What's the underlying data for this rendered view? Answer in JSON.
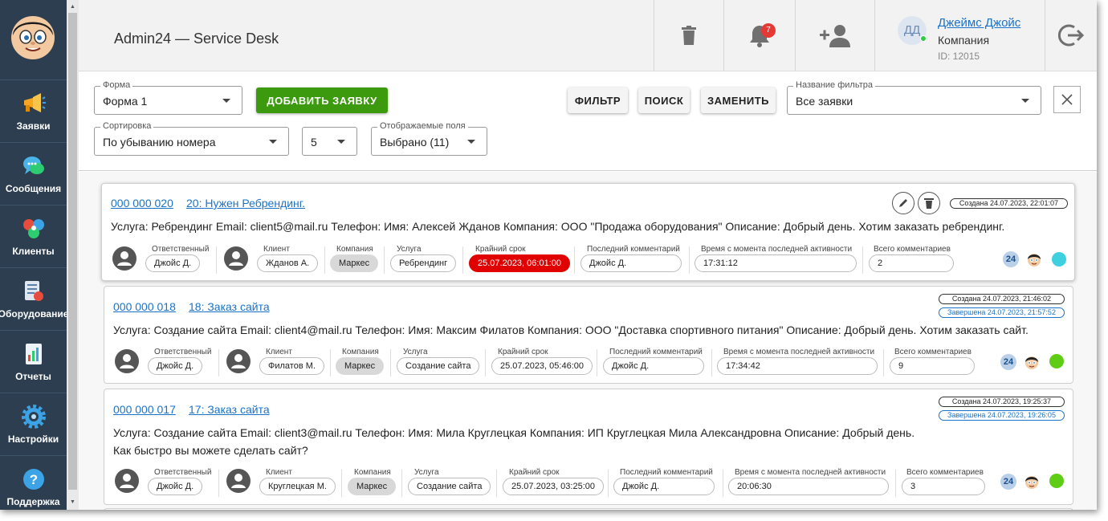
{
  "sidebar": {
    "items": [
      {
        "label": "Заявки",
        "icon": "megaphone-icon"
      },
      {
        "label": "Сообщения",
        "icon": "chat-icon"
      },
      {
        "label": "Клиенты",
        "icon": "clients-icon"
      },
      {
        "label": "Оборудование",
        "icon": "equipment-icon"
      },
      {
        "label": "Отчеты",
        "icon": "reports-icon"
      },
      {
        "label": "Настройки",
        "icon": "gear-icon"
      },
      {
        "label": "Поддержка",
        "icon": "help-icon"
      }
    ]
  },
  "header": {
    "title": "Admin24 — Service Desk",
    "notifications_count": "7",
    "user": {
      "initials": "ДД",
      "name": "Джеймс Джойс",
      "company": "Компания",
      "id": "ID: 12015"
    }
  },
  "toolbar": {
    "form_label": "Форма",
    "form_value": "Форма 1",
    "add_button": "ДОБАВИТЬ ЗАЯВКУ",
    "filter_button": "ФИЛЬТР",
    "search_button": "ПОИСК",
    "replace_button": "ЗАМЕНИТЬ",
    "filter_name_label": "Название фильтра",
    "filter_name_value": "Все заявки",
    "sort_label": "Сортировка",
    "sort_value": "По убыванию номера",
    "page_size_value": "5",
    "fields_label": "Отображаемые поля",
    "fields_value": "Выбрано (11)"
  },
  "meta_labels": {
    "responsible": "Ответственный",
    "client": "Клиент",
    "company": "Компания",
    "service": "Услуга",
    "deadline": "Крайний срок",
    "last_comment": "Последний комментарий",
    "since_activity": "Время с момента последней активности",
    "total_comments": "Всего комментариев"
  },
  "tickets": [
    {
      "number": "000 000 020",
      "title": "20: Нужен Ребрендинг.",
      "created": "Создана 24.07.2023, 22:01:07",
      "description": "Услуга: Ребрендинг Email: client5@mail.ru Телефон: Имя: Алексей Жданов Компания: ООО \"Продажа оборудования\" Описание: Добрый день. Хотим заказать ребрендинг.",
      "responsible": "Джойс Д.",
      "client": "Жданов А.",
      "company": "Маркес",
      "service": "Ребрендинг",
      "deadline": "25.07.2023, 06:01:00",
      "last_comment": "Джойс Д.",
      "since_activity": "17:31:12",
      "total_comments": "2",
      "badge": "24",
      "status_color": "#3fd0e0"
    },
    {
      "number": "000 000 018",
      "title": "18: Заказ сайта",
      "created": "Создана 24.07.2023, 21:46:02",
      "completed": "Завершена 24.07.2023, 21:57:52",
      "description": "Услуга: Создание сайта Email: client4@mail.ru Телефон: Имя: Максим Филатов Компания: ООО \"Доставка спортивного питания\" Описание: Добрый день. Хотим заказать сайт.",
      "responsible": "Джойс Д.",
      "client": "Филатов М.",
      "company": "Маркес",
      "service": "Создание сайта",
      "deadline": "25.07.2023, 05:46:00",
      "last_comment": "Джойс Д.",
      "since_activity": "17:34:42",
      "total_comments": "9",
      "badge": "24",
      "status_color": "#5fcc16"
    },
    {
      "number": "000 000 017",
      "title": "17: Заказ сайта",
      "created": "Создана 24.07.2023, 19:25:37",
      "completed": "Завершена 24.07.2023, 19:26:05",
      "description": "Услуга: Создание сайта Email: client3@mail.ru Телефон: Имя: Мила Круглецкая Компания: ИП Круглецкая Мила Александровна Описание: Добрый день. Как быстро вы можете сделать сайт?",
      "responsible": "Джойс Д.",
      "client": "Круглецкая М.",
      "company": "Маркес",
      "service": "Создание сайта",
      "deadline": "25.07.2023, 03:25:00",
      "last_comment": "Джойс Д.",
      "since_activity": "20:06:30",
      "total_comments": "3",
      "badge": "24",
      "status_color": "#5fcc16"
    }
  ]
}
